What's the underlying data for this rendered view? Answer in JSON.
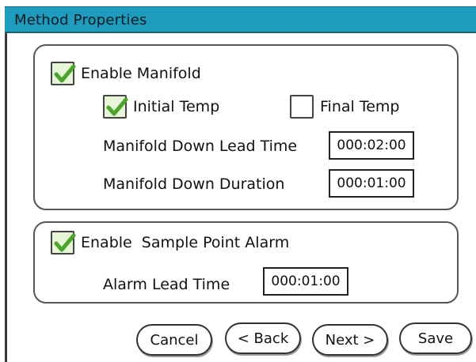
{
  "window": {
    "title": "Method Properties"
  },
  "manifold": {
    "enable_label": "Enable Manifold",
    "enable_checked": true,
    "initial_temp_label": "Initial Temp",
    "initial_temp_checked": true,
    "final_temp_label": "Final Temp",
    "final_temp_checked": false,
    "lead_time_label": "Manifold Down Lead Time",
    "lead_time_value": "000:02:00",
    "duration_label": "Manifold Down Duration",
    "duration_value": "000:01:00"
  },
  "alarm": {
    "enable_label": "Enable  Sample Point Alarm",
    "enable_checked": true,
    "lead_time_label": "Alarm Lead Time",
    "lead_time_value": "000:01:00"
  },
  "buttons": {
    "cancel": "Cancel",
    "back": "< Back",
    "next": "Next >",
    "save": "Save"
  },
  "colors": {
    "titlebar": "#1e9cbd",
    "check": "#4aa52a"
  },
  "icons": {
    "checked": "check-mark-icon"
  }
}
